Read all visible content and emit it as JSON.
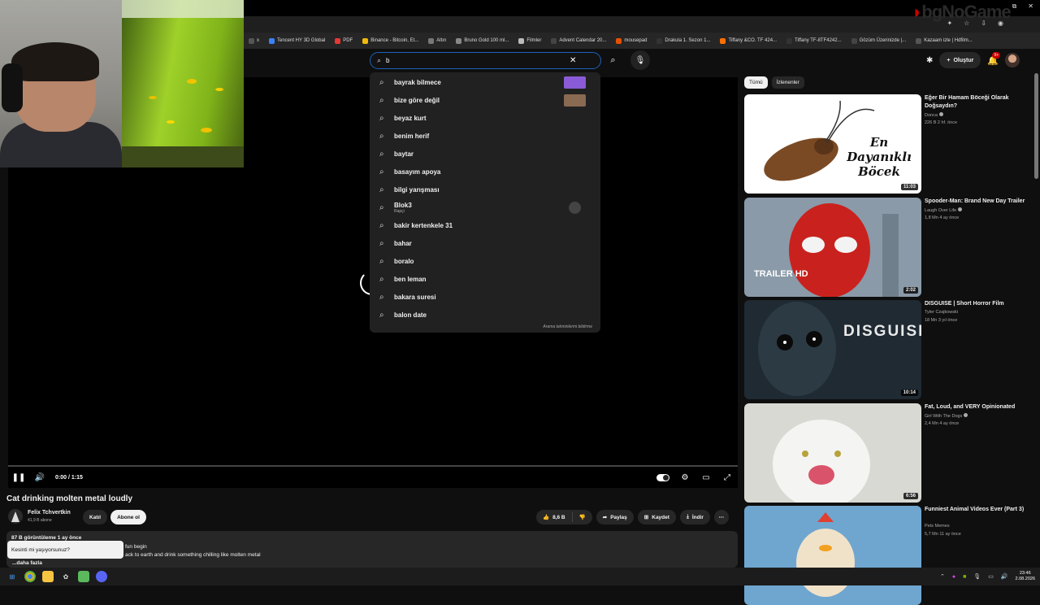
{
  "browser": {
    "bookmarks": [
      {
        "label": "x",
        "color": "#555"
      },
      {
        "label": "Tencent HY 3D Global",
        "color": "#3b82f6"
      },
      {
        "label": "PDF",
        "color": "#e53935"
      },
      {
        "label": "Binance - Bitcoin, Et...",
        "color": "#f0b90b"
      },
      {
        "label": "Altın",
        "color": "#777"
      },
      {
        "label": "Bruno Gold 100 ml...",
        "color": "#888"
      },
      {
        "label": "Filmler",
        "color": "#bbb"
      },
      {
        "label": "Advent Calendar 20...",
        "color": "#444"
      },
      {
        "label": "mousepad",
        "color": "#e65100"
      },
      {
        "label": "Drakula 1. Sezon 1...",
        "color": "#333"
      },
      {
        "label": "Tiffany &CO. TF 424...",
        "color": "#ff6f00"
      },
      {
        "label": "Tiffany TF-8TF4242...",
        "color": "#333"
      },
      {
        "label": "Gözüm Üzerinizde |...",
        "color": "#444"
      },
      {
        "label": "Kazaam izle | Hdfilm...",
        "color": "#555"
      }
    ]
  },
  "watermark": {
    "text": "bgNoGame"
  },
  "search": {
    "value": "b",
    "suggestions": [
      {
        "text": "bayrak bilmece",
        "thumb": "#8a5bd6"
      },
      {
        "text": "bize göre değil",
        "thumb": "#8a6a52"
      },
      {
        "text": "beyaz kurt"
      },
      {
        "text": "benim herif"
      },
      {
        "text": "baytar"
      },
      {
        "text": "basayım apoya"
      },
      {
        "text": "bilgi yarışması"
      },
      {
        "text": "Blok3",
        "sub": "Rapçi",
        "thumb": "#444"
      },
      {
        "text": "bakir kertenkele 31"
      },
      {
        "text": "bahar"
      },
      {
        "text": "boralo"
      },
      {
        "text": "ben leman"
      },
      {
        "text": "bakara suresi"
      },
      {
        "text": "balon date"
      }
    ],
    "footer": "Arama tahminlerini bildirme"
  },
  "header": {
    "create_label": "Oluştur",
    "notif_count": "9+"
  },
  "player": {
    "time": "0:00 / 1:15",
    "progress": 0.0
  },
  "video": {
    "title": "Cat drinking molten metal loudly",
    "channel": "Felix Tchvertkin",
    "subs": "41,9 B abone",
    "join_label": "Katıl",
    "subscribe_label": "Abone ol",
    "likes": "8,6 B",
    "share_label": "Paylaş",
    "save_label": "Kaydet",
    "download_label": "İndir",
    "desc_meta": "87 B görüntüleme  1 ay önce",
    "desc_line1": "fun begin",
    "desc_line2": "ack to earth and drink something chilling like molten metal",
    "desc_more": "...daha fazla",
    "popup": "Kesinti mi yaşıyorsunuz?"
  },
  "sidebar": {
    "chips": [
      {
        "label": "Tümü",
        "active": true
      },
      {
        "label": "İzlenenler",
        "active": false
      }
    ],
    "recs": [
      {
        "title": "Eğer Bir Hamam Böceği Olarak Doğsaydın?",
        "channel": "Donca",
        "verified": true,
        "meta": "226 B  2 hf. önce",
        "duration": "11:03",
        "thumb_text": "En Dayanıklı Böcek",
        "thumb_bg": "#ffffff"
      },
      {
        "title": "Spooder-Man: Brand New Day Trailer",
        "channel": "Laugh Over Life",
        "verified": true,
        "meta": "1,8 Mn  4 ay önce",
        "duration": "2:02",
        "thumb_text": "TRAILER HD",
        "thumb_bg": "#8a9aa8"
      },
      {
        "title": "DISGUISE | Short Horror Film",
        "channel": "Tyler Czajkowski",
        "verified": false,
        "meta": "18 Mn  3 yıl önce",
        "duration": "10:14",
        "thumb_text": "DISGUISE",
        "thumb_bg": "#1f2a33"
      },
      {
        "title": "Fat, Loud, and VERY Opinionated",
        "channel": "Girl With The Dogs",
        "verified": true,
        "meta": "2,4 Mn  4 ay önce",
        "duration": "6:56",
        "thumb_text": "",
        "thumb_bg": "#d9d9d4"
      },
      {
        "title": "Funniest Animal Videos Ever (Part 3)",
        "channel": "Pets Memes",
        "verified": false,
        "meta": "5,7 Mn  11 ay önce",
        "duration": "",
        "thumb_text": "",
        "thumb_bg": "#6fa6d0"
      }
    ]
  },
  "taskbar": {
    "time": "23:46",
    "date": "2.08.2026"
  }
}
